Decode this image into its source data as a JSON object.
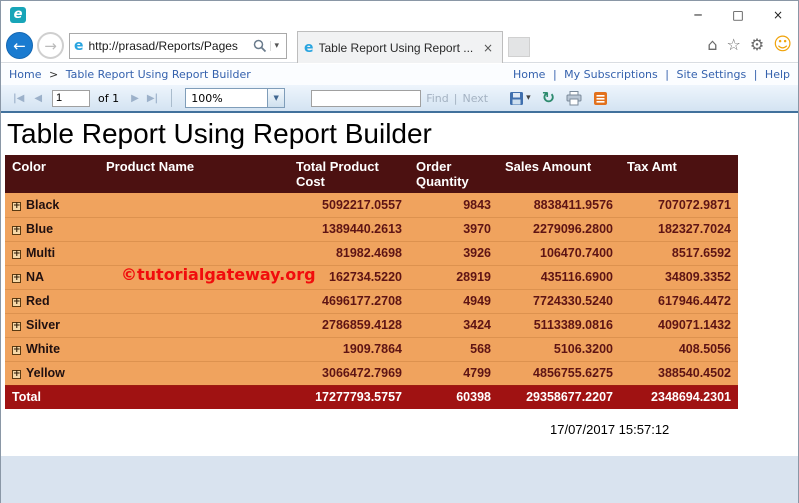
{
  "titlebar": {
    "icons": {
      "app": "e",
      "minimize": "─",
      "maximize": "□",
      "close": "×"
    }
  },
  "navbar": {
    "back": "←",
    "forward": "→",
    "address": {
      "ie": "e",
      "url": "http://prasad/Reports/Pages",
      "caret": "▾"
    },
    "tab": {
      "ie": "e",
      "title": "Table Report Using Report ...",
      "close": "×"
    },
    "right_icons": {
      "home": "⌂",
      "favorites": "☆",
      "tools": "⚙",
      "smiley": "☺"
    }
  },
  "breadcrumb": {
    "home": "Home",
    "separator": ">",
    "current": "Table Report Using Report Builder",
    "links": [
      "Home",
      "My Subscriptions",
      "Site Settings",
      "Help"
    ],
    "pipe": "|"
  },
  "toolbar": {
    "first": "|◀",
    "prev": "◀",
    "page_value": "1",
    "of_label": "of 1",
    "next_arrow": "▶",
    "last": "▶|",
    "zoom_value": "100%",
    "select_arrow": "▼",
    "find_label": "Find",
    "pipe": "|",
    "next_label": "Next",
    "export_caret": "▾",
    "refresh": "↻"
  },
  "report": {
    "title": "Table Report Using Report Builder",
    "watermark": "©tutorialgateway.org",
    "timestamp": "17/07/2017 15:57:12"
  },
  "table": {
    "expand_glyph": "+",
    "headers": [
      "Color",
      "Product Name",
      "Total Product Cost",
      "Order Quantity",
      "Sales Amount",
      "Tax Amt"
    ],
    "rows": [
      {
        "name": "Black",
        "cost": "5092217.0557",
        "qty": "9843",
        "sales": "8838411.9576",
        "tax": "707072.9871"
      },
      {
        "name": "Blue",
        "cost": "1389440.2613",
        "qty": "3970",
        "sales": "2279096.2800",
        "tax": "182327.7024"
      },
      {
        "name": "Multi",
        "cost": "81982.4698",
        "qty": "3926",
        "sales": "106470.7400",
        "tax": "8517.6592"
      },
      {
        "name": "NA",
        "cost": "162734.5220",
        "qty": "28919",
        "sales": "435116.6900",
        "tax": "34809.3352"
      },
      {
        "name": "Red",
        "cost": "4696177.2708",
        "qty": "4949",
        "sales": "7724330.5240",
        "tax": "617946.4472"
      },
      {
        "name": "Silver",
        "cost": "2786859.4128",
        "qty": "3424",
        "sales": "5113389.0816",
        "tax": "409071.1432"
      },
      {
        "name": "White",
        "cost": "1909.7864",
        "qty": "568",
        "sales": "5106.3200",
        "tax": "408.5056"
      },
      {
        "name": "Yellow",
        "cost": "3066472.7969",
        "qty": "4799",
        "sales": "4856755.6275",
        "tax": "388540.4502"
      }
    ],
    "total": {
      "label": "Total",
      "cost": "17277793.5757",
      "qty": "60398",
      "sales": "29358677.2207",
      "tax": "2348694.2301"
    }
  },
  "colors": {
    "header_bg": "#4c1111",
    "row_bg": "#f0a35e",
    "total_bg": "#a01212",
    "number_text": "#5e1414",
    "link_blue": "#3461ad",
    "watermark_red": "#f10c0c",
    "toolbar_border": "#41719c"
  }
}
